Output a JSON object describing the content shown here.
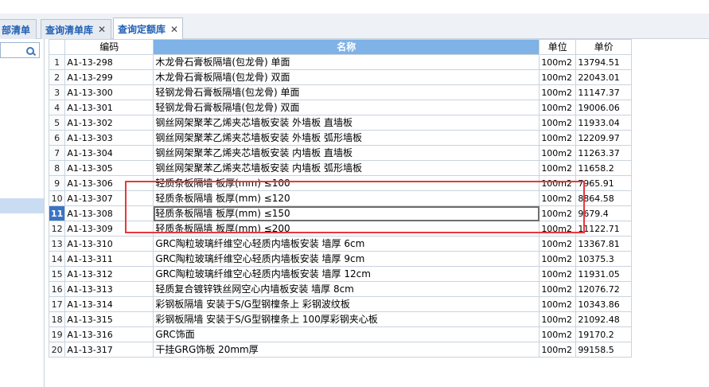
{
  "tabs": [
    {
      "label": "部清单"
    },
    {
      "label": "查询清单库"
    },
    {
      "label": "查询定额库"
    }
  ],
  "tab_close": "✕",
  "columns": {
    "code": "编码",
    "name": "名称",
    "unit": "单位",
    "price": "单价"
  },
  "rows": [
    {
      "n": "1",
      "code": "A1-13-298",
      "name": "木龙骨石膏板隔墙(包龙骨) 单面",
      "unit": "100m2",
      "price": "13794.51"
    },
    {
      "n": "2",
      "code": "A1-13-299",
      "name": "木龙骨石膏板隔墙(包龙骨) 双面",
      "unit": "100m2",
      "price": "22043.01"
    },
    {
      "n": "3",
      "code": "A1-13-300",
      "name": "轻钢龙骨石膏板隔墙(包龙骨) 单面",
      "unit": "100m2",
      "price": "11147.37"
    },
    {
      "n": "4",
      "code": "A1-13-301",
      "name": "轻钢龙骨石膏板隔墙(包龙骨) 双面",
      "unit": "100m2",
      "price": "19006.06"
    },
    {
      "n": "5",
      "code": "A1-13-302",
      "name": "钢丝网架聚苯乙烯夹芯墙板安装 外墙板 直墙板",
      "unit": "100m2",
      "price": "11933.04"
    },
    {
      "n": "6",
      "code": "A1-13-303",
      "name": "钢丝网架聚苯乙烯夹芯墙板安装 外墙板 弧形墙板",
      "unit": "100m2",
      "price": "12209.97"
    },
    {
      "n": "7",
      "code": "A1-13-304",
      "name": "钢丝网架聚苯乙烯夹芯墙板安装 内墙板 直墙板",
      "unit": "100m2",
      "price": "11263.37"
    },
    {
      "n": "8",
      "code": "A1-13-305",
      "name": "钢丝网架聚苯乙烯夹芯墙板安装 内墙板 弧形墙板",
      "unit": "100m2",
      "price": "11658.2"
    },
    {
      "n": "9",
      "code": "A1-13-306",
      "name": "轻质条板隔墙 板厚(mm) ≤100",
      "unit": "100m2",
      "price": "7965.91"
    },
    {
      "n": "10",
      "code": "A1-13-307",
      "name": "轻质条板隔墙 板厚(mm) ≤120",
      "unit": "100m2",
      "price": "8864.58"
    },
    {
      "n": "11",
      "code": "A1-13-308",
      "name": "轻质条板隔墙 板厚(mm) ≤150",
      "unit": "100m2",
      "price": "9679.4"
    },
    {
      "n": "12",
      "code": "A1-13-309",
      "name": "轻质条板隔墙 板厚(mm) ≤200",
      "unit": "100m2",
      "price": "11122.71"
    },
    {
      "n": "13",
      "code": "A1-13-310",
      "name": "GRC陶粒玻璃纤维空心轻质内墙板安装 墙厚 6cm",
      "unit": "100m2",
      "price": "13367.81"
    },
    {
      "n": "14",
      "code": "A1-13-311",
      "name": "GRC陶粒玻璃纤维空心轻质内墙板安装 墙厚 9cm",
      "unit": "100m2",
      "price": "10375.3"
    },
    {
      "n": "15",
      "code": "A1-13-312",
      "name": "GRC陶粒玻璃纤维空心轻质内墙板安装 墙厚 12cm",
      "unit": "100m2",
      "price": "11931.05"
    },
    {
      "n": "16",
      "code": "A1-13-313",
      "name": "轻质复合镀锌铁丝网空心内墙板安装 墙厚 8cm",
      "unit": "100m2",
      "price": "12076.72"
    },
    {
      "n": "17",
      "code": "A1-13-314",
      "name": "彩钢板隔墙 安装于S/G型钢檁条上 彩钢波纹板",
      "unit": "100m2",
      "price": "10343.86"
    },
    {
      "n": "18",
      "code": "A1-13-315",
      "name": "彩钢板隔墙 安装于S/G型钢檁条上 100厚彩钢夹心板",
      "unit": "100m2",
      "price": "21092.48"
    },
    {
      "n": "19",
      "code": "A1-13-316",
      "name": "GRC饰面",
      "unit": "100m2",
      "price": "19170.2"
    },
    {
      "n": "20",
      "code": "A1-13-317",
      "name": "干挂GRG饰板 20mm厚",
      "unit": "100m2",
      "price": "99158.5"
    }
  ],
  "selected_row": "11",
  "colors": {
    "accent": "#3b73c4",
    "header_blue": "#7fb2e6",
    "highlight": "#e8373e"
  },
  "icons": {
    "search": "search-icon",
    "close": "close-icon"
  }
}
